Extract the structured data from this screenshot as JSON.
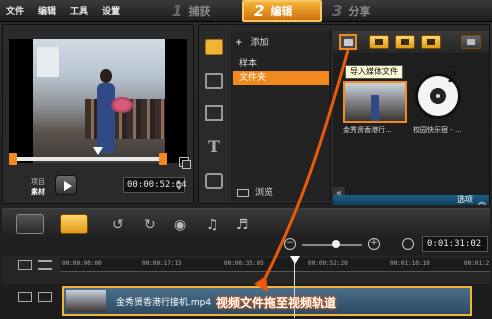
{
  "menu": [
    "文件",
    "编辑",
    "工具",
    "设置"
  ],
  "steps": [
    {
      "num": "1",
      "label": "捕获",
      "active": false
    },
    {
      "num": "2",
      "label": "编辑",
      "active": true
    },
    {
      "num": "3",
      "label": "分享",
      "active": false
    }
  ],
  "preview": {
    "mode_project": "项目",
    "mode_clip": "素材",
    "timecode": "00:00:52:04"
  },
  "library": {
    "add_label": "添加",
    "nav_items": [
      "样本",
      "文件夹"
    ],
    "browse_label": "浏览",
    "tooltip": "导入媒体文件",
    "items": [
      {
        "caption": "金秀贤香港行..."
      },
      {
        "caption": "校园快乐宿 - ..."
      }
    ],
    "options_label": "选项"
  },
  "timeline": {
    "time": "0:01:31:02",
    "ruler_labels": [
      "00:00:00:00",
      "00:00:17:15",
      "00:00:35:05",
      "00:00:52:20",
      "00:01:10:10",
      "00:01:2"
    ],
    "clip_name": "金秀贤香港行接机.mp4"
  },
  "annotation": {
    "text": "视频文件拖至视频轨道",
    "color": "#e85b0c"
  },
  "colors": {
    "accent": "#f08a1c",
    "selected_step": "#f6b43a"
  }
}
